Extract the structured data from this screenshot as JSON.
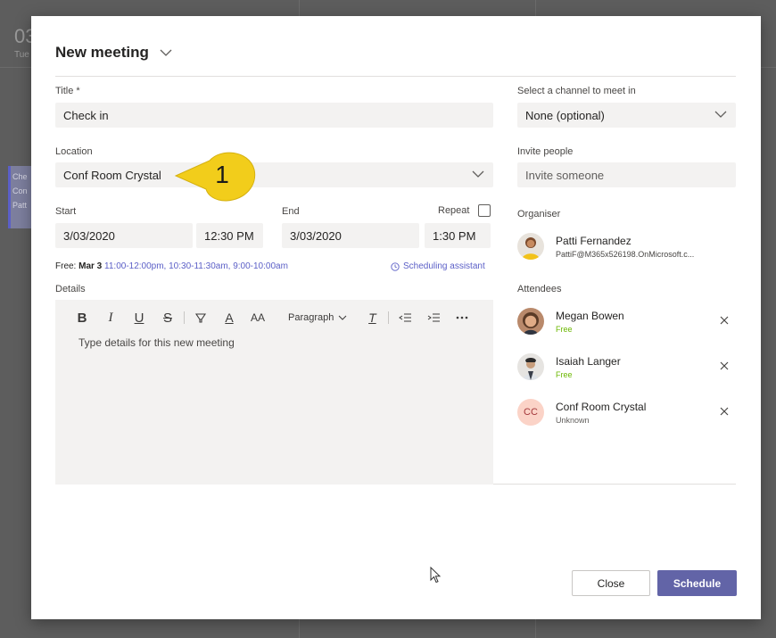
{
  "background": {
    "date": "03",
    "day": "Tue",
    "event_lines": [
      "Che",
      "Con",
      "Patt"
    ]
  },
  "modal": {
    "title": "New meeting",
    "title_label": "Title *",
    "title_value": "Check in",
    "location_label": "Location",
    "location_value": "Conf Room Crystal",
    "start_label": "Start",
    "start_date": "3/03/2020",
    "start_time": "12:30 PM",
    "end_label": "End",
    "end_date": "3/03/2020",
    "end_time": "1:30 PM",
    "repeat_label": "Repeat",
    "repeat_checked": false,
    "free_prefix": "Free:",
    "free_day": "Mar 3",
    "free_slots": "11:00-12:00pm,  10:30-11:30am,  9:00-10:00am",
    "scheduling_assistant": "Scheduling assistant",
    "details_label": "Details",
    "details_placeholder": "Type details for this new meeting",
    "toolbar": {
      "bold": "B",
      "italic": "I",
      "underline": "U",
      "strike": "S",
      "font_color": "A",
      "font_size": "AA",
      "paragraph": "Paragraph",
      "clear_format": "T"
    },
    "channel_label": "Select a channel to meet in",
    "channel_value": "None (optional)",
    "invite_label": "Invite people",
    "invite_placeholder": "Invite someone",
    "organiser_label": "Organiser",
    "organiser": {
      "name": "Patti Fernandez",
      "email": "PattiF@M365x526198.OnMicrosoft.c..."
    },
    "attendees_label": "Attendees",
    "attendees": [
      {
        "name": "Megan Bowen",
        "status": "Free"
      },
      {
        "name": "Isaiah Langer",
        "status": "Free"
      },
      {
        "name": "Conf Room Crystal",
        "status": "Unknown",
        "initials": "CC"
      }
    ],
    "close_label": "Close",
    "schedule_label": "Schedule"
  },
  "callout": {
    "number": "1"
  },
  "colors": {
    "accent": "#6264a7",
    "link": "#5b5fc7",
    "free": "#6bb700",
    "field_bg": "#f3f2f1",
    "callout": "#f2cd1b"
  }
}
